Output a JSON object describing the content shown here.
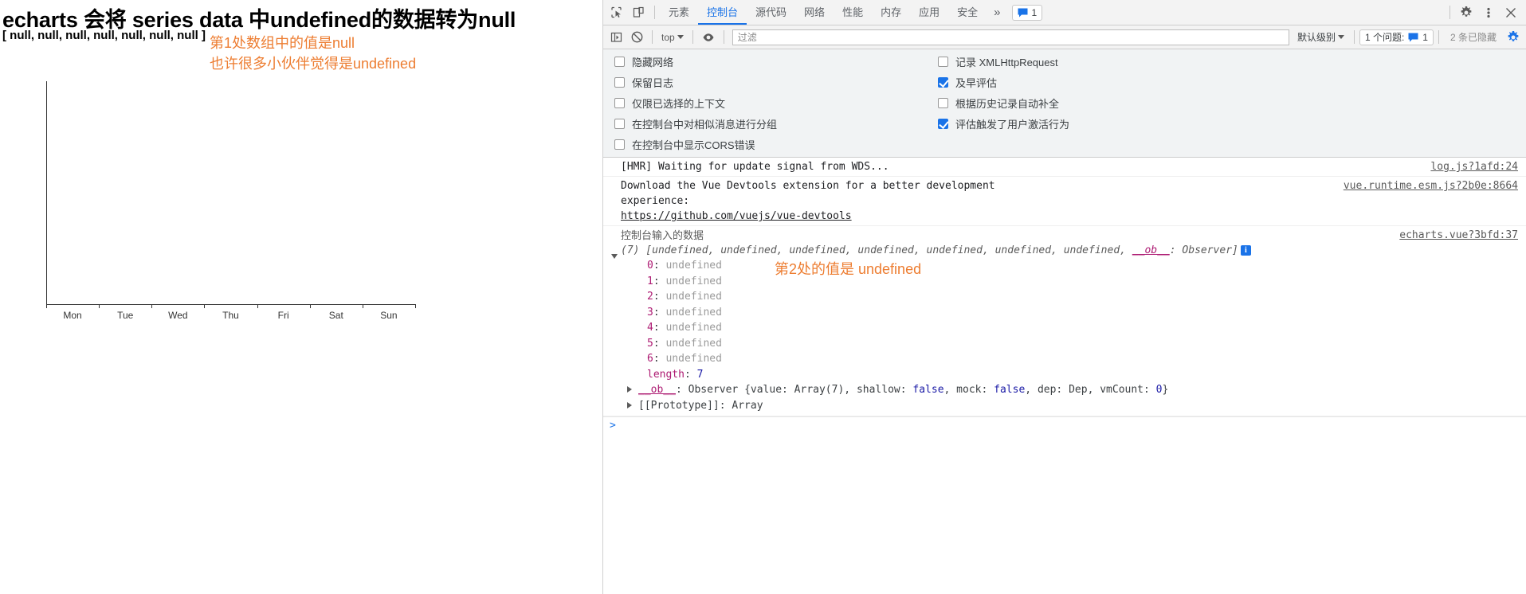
{
  "left_panel": {
    "title": "echarts 会将 series data 中undefined的数据转为null",
    "null_array": "[ null, null, null, null, null, null, null ]",
    "annotation_1": "第1处数组中的值是null",
    "annotation_2": "也许很多小伙伴觉得是undefined",
    "annotation_color": "#ED7D31"
  },
  "chart_data": {
    "type": "bar",
    "title": "",
    "categories": [
      "Mon",
      "Tue",
      "Wed",
      "Thu",
      "Fri",
      "Sat",
      "Sun"
    ],
    "values": [
      null,
      null,
      null,
      null,
      null,
      null,
      null
    ],
    "xlabel": "",
    "ylabel": "",
    "grid": false,
    "legend_position": "none",
    "note": "all series values are null so no bars are rendered"
  },
  "devtools": {
    "tabs": [
      {
        "label": "元素",
        "active": false
      },
      {
        "label": "控制台",
        "active": true
      },
      {
        "label": "源代码",
        "active": false
      },
      {
        "label": "网络",
        "active": false
      },
      {
        "label": "性能",
        "active": false
      },
      {
        "label": "内存",
        "active": false
      },
      {
        "label": "应用",
        "active": false
      },
      {
        "label": "安全",
        "active": false
      }
    ],
    "more_tabs_glyph": "»",
    "issue_count": "1",
    "toolbar": {
      "context_value": "top",
      "filter_placeholder": "过滤",
      "filter_value": "",
      "level_label": "默认级别",
      "problems_label": "1 个问题:",
      "problems_count": "1",
      "hidden_label": "2 条已隐藏"
    },
    "settings_left": [
      {
        "label": "隐藏网络",
        "checked": false
      },
      {
        "label": "保留日志",
        "checked": false
      },
      {
        "label": "仅限已选择的上下文",
        "checked": false
      },
      {
        "label": "在控制台中对相似消息进行分组",
        "checked": false
      },
      {
        "label": "在控制台中显示CORS错误",
        "checked": false
      }
    ],
    "settings_right": [
      {
        "label": "记录 XMLHttpRequest",
        "checked": false
      },
      {
        "label": "及早评估",
        "checked": true
      },
      {
        "label": "根据历史记录自动补全",
        "checked": false
      },
      {
        "label": "评估触发了用户激活行为",
        "checked": true
      }
    ],
    "messages": {
      "hmr": {
        "text": "[HMR] Waiting for update signal from WDS...",
        "source": "log.js?1afd:24"
      },
      "vue_devtools": {
        "line1": "Download the Vue Devtools extension for a better development",
        "line2": "experience:",
        "link": "https://github.com/vuejs/vue-devtools",
        "source": "vue.runtime.esm.js?2b0e:8664"
      },
      "group": {
        "title": "控制台输入的数据",
        "source": "echarts.vue?3bfd:37",
        "array_preview_prefix": "(7) [",
        "array_preview_items": "undefined, undefined, undefined, undefined, undefined, undefined, undefined",
        "array_preview_ob_key": "__ob__",
        "array_preview_ob_val": "Observer]",
        "info_badge": "i",
        "entries": [
          {
            "key": "0",
            "value": "undefined"
          },
          {
            "key": "1",
            "value": "undefined"
          },
          {
            "key": "2",
            "value": "undefined"
          },
          {
            "key": "3",
            "value": "undefined"
          },
          {
            "key": "4",
            "value": "undefined"
          },
          {
            "key": "5",
            "value": "undefined"
          },
          {
            "key": "6",
            "value": "undefined"
          }
        ],
        "length_key": "length",
        "length_value": "7",
        "ob_key": "__ob__",
        "ob_value": "Observer {value: Array(7), shallow: false, mock: false, dep: Dep, vmCount: 0}",
        "prototype_row": "[[Prototype]]: Array"
      },
      "annotation_3": "第2处的值是 undefined"
    },
    "prompt": ">"
  }
}
